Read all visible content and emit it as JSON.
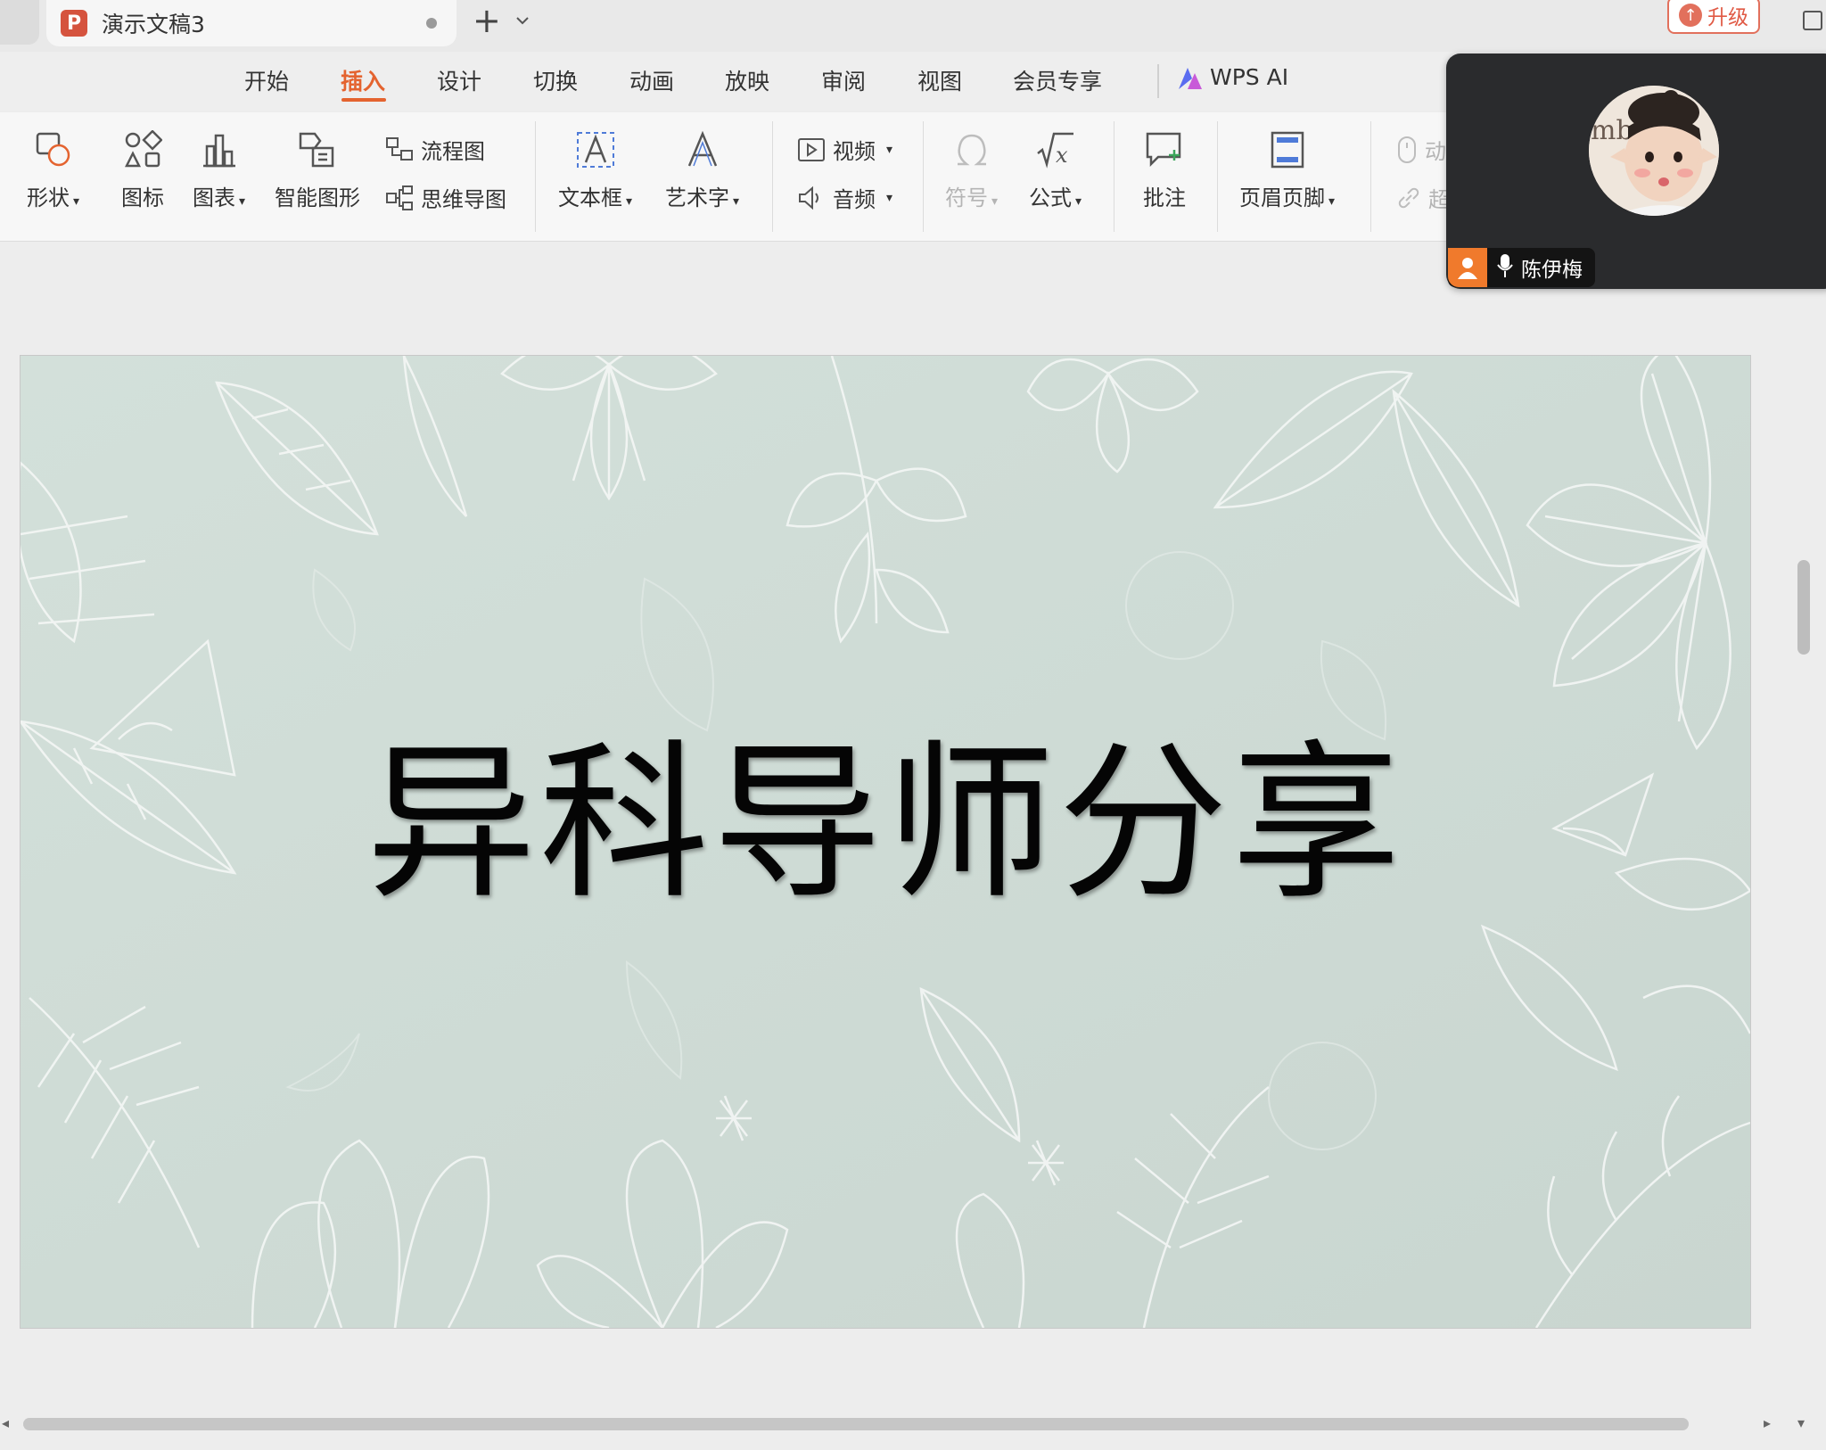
{
  "tabbar": {
    "doc_title": "演示文稿3",
    "app_badge": "P",
    "new_tab": "+",
    "upgrade_label": "升级"
  },
  "menu": {
    "items": [
      "开始",
      "插入",
      "设计",
      "切换",
      "动画",
      "放映",
      "审阅",
      "视图",
      "会员专享"
    ],
    "active": "插入",
    "ai_label": "WPS AI"
  },
  "ribbon": {
    "shape": "形状",
    "icon": "图标",
    "chart": "图表",
    "smartart": "智能图形",
    "flowchart": "流程图",
    "mindmap": "思维导图",
    "textbox": "文本框",
    "wordart": "艺术字",
    "video": "视频",
    "audio": "音频",
    "symbol": "符号",
    "formula": "公式",
    "comment": "批注",
    "header_footer": "页眉页脚",
    "action_partial": "动",
    "hyperlink_partial": "超"
  },
  "call": {
    "participant_name": "陈伊梅",
    "avatar_text": "mb"
  },
  "slide": {
    "title": "异科导师分享"
  },
  "colors": {
    "accent": "#e4632f",
    "slide_bg": "#cfdcd6",
    "call_bg": "#2a2b2d"
  }
}
